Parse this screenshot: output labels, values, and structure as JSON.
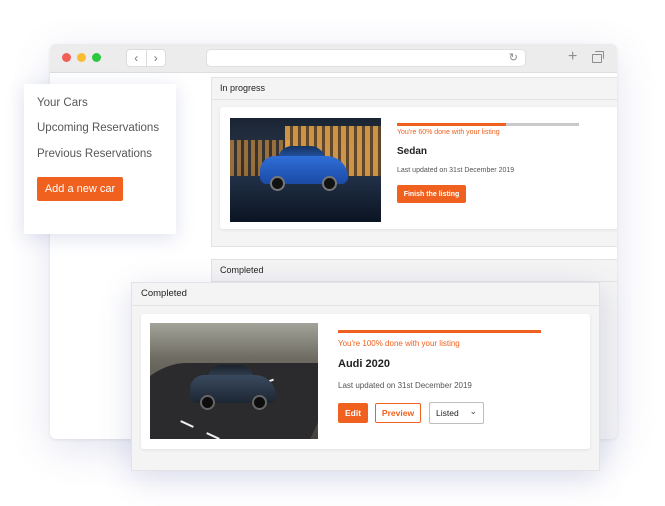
{
  "sidebar": {
    "items": [
      {
        "label": "Your Cars"
      },
      {
        "label": "Upcoming Reservations"
      },
      {
        "label": "Previous Reservations"
      }
    ],
    "add_button": "Add a new car"
  },
  "in_progress": {
    "header": "In progress",
    "listing": {
      "progress_percent": 60,
      "progress_text": "You're 60% done with your listing",
      "title": "Sedan",
      "updated": "Last updated on 31st December 2019",
      "action_label": "Finish the listing"
    }
  },
  "completed_background": {
    "header": "Completed"
  },
  "completed": {
    "header": "Completed",
    "listing": {
      "progress_percent": 100,
      "progress_text": "You're 100% done with your listing",
      "title": "Audi 2020",
      "updated": "Last updated on 31st December 2019",
      "edit_label": "Edit",
      "preview_label": "Preview",
      "status_value": "Listed"
    }
  },
  "colors": {
    "accent": "#f0611f",
    "panel_bg": "#f4f4f4",
    "track": "#c9c9c9"
  },
  "icons": [
    "back-arrow-icon",
    "forward-arrow-icon",
    "reload-icon",
    "new-tab-plus-icon",
    "tabs-icon",
    "chevron-down-icon"
  ]
}
